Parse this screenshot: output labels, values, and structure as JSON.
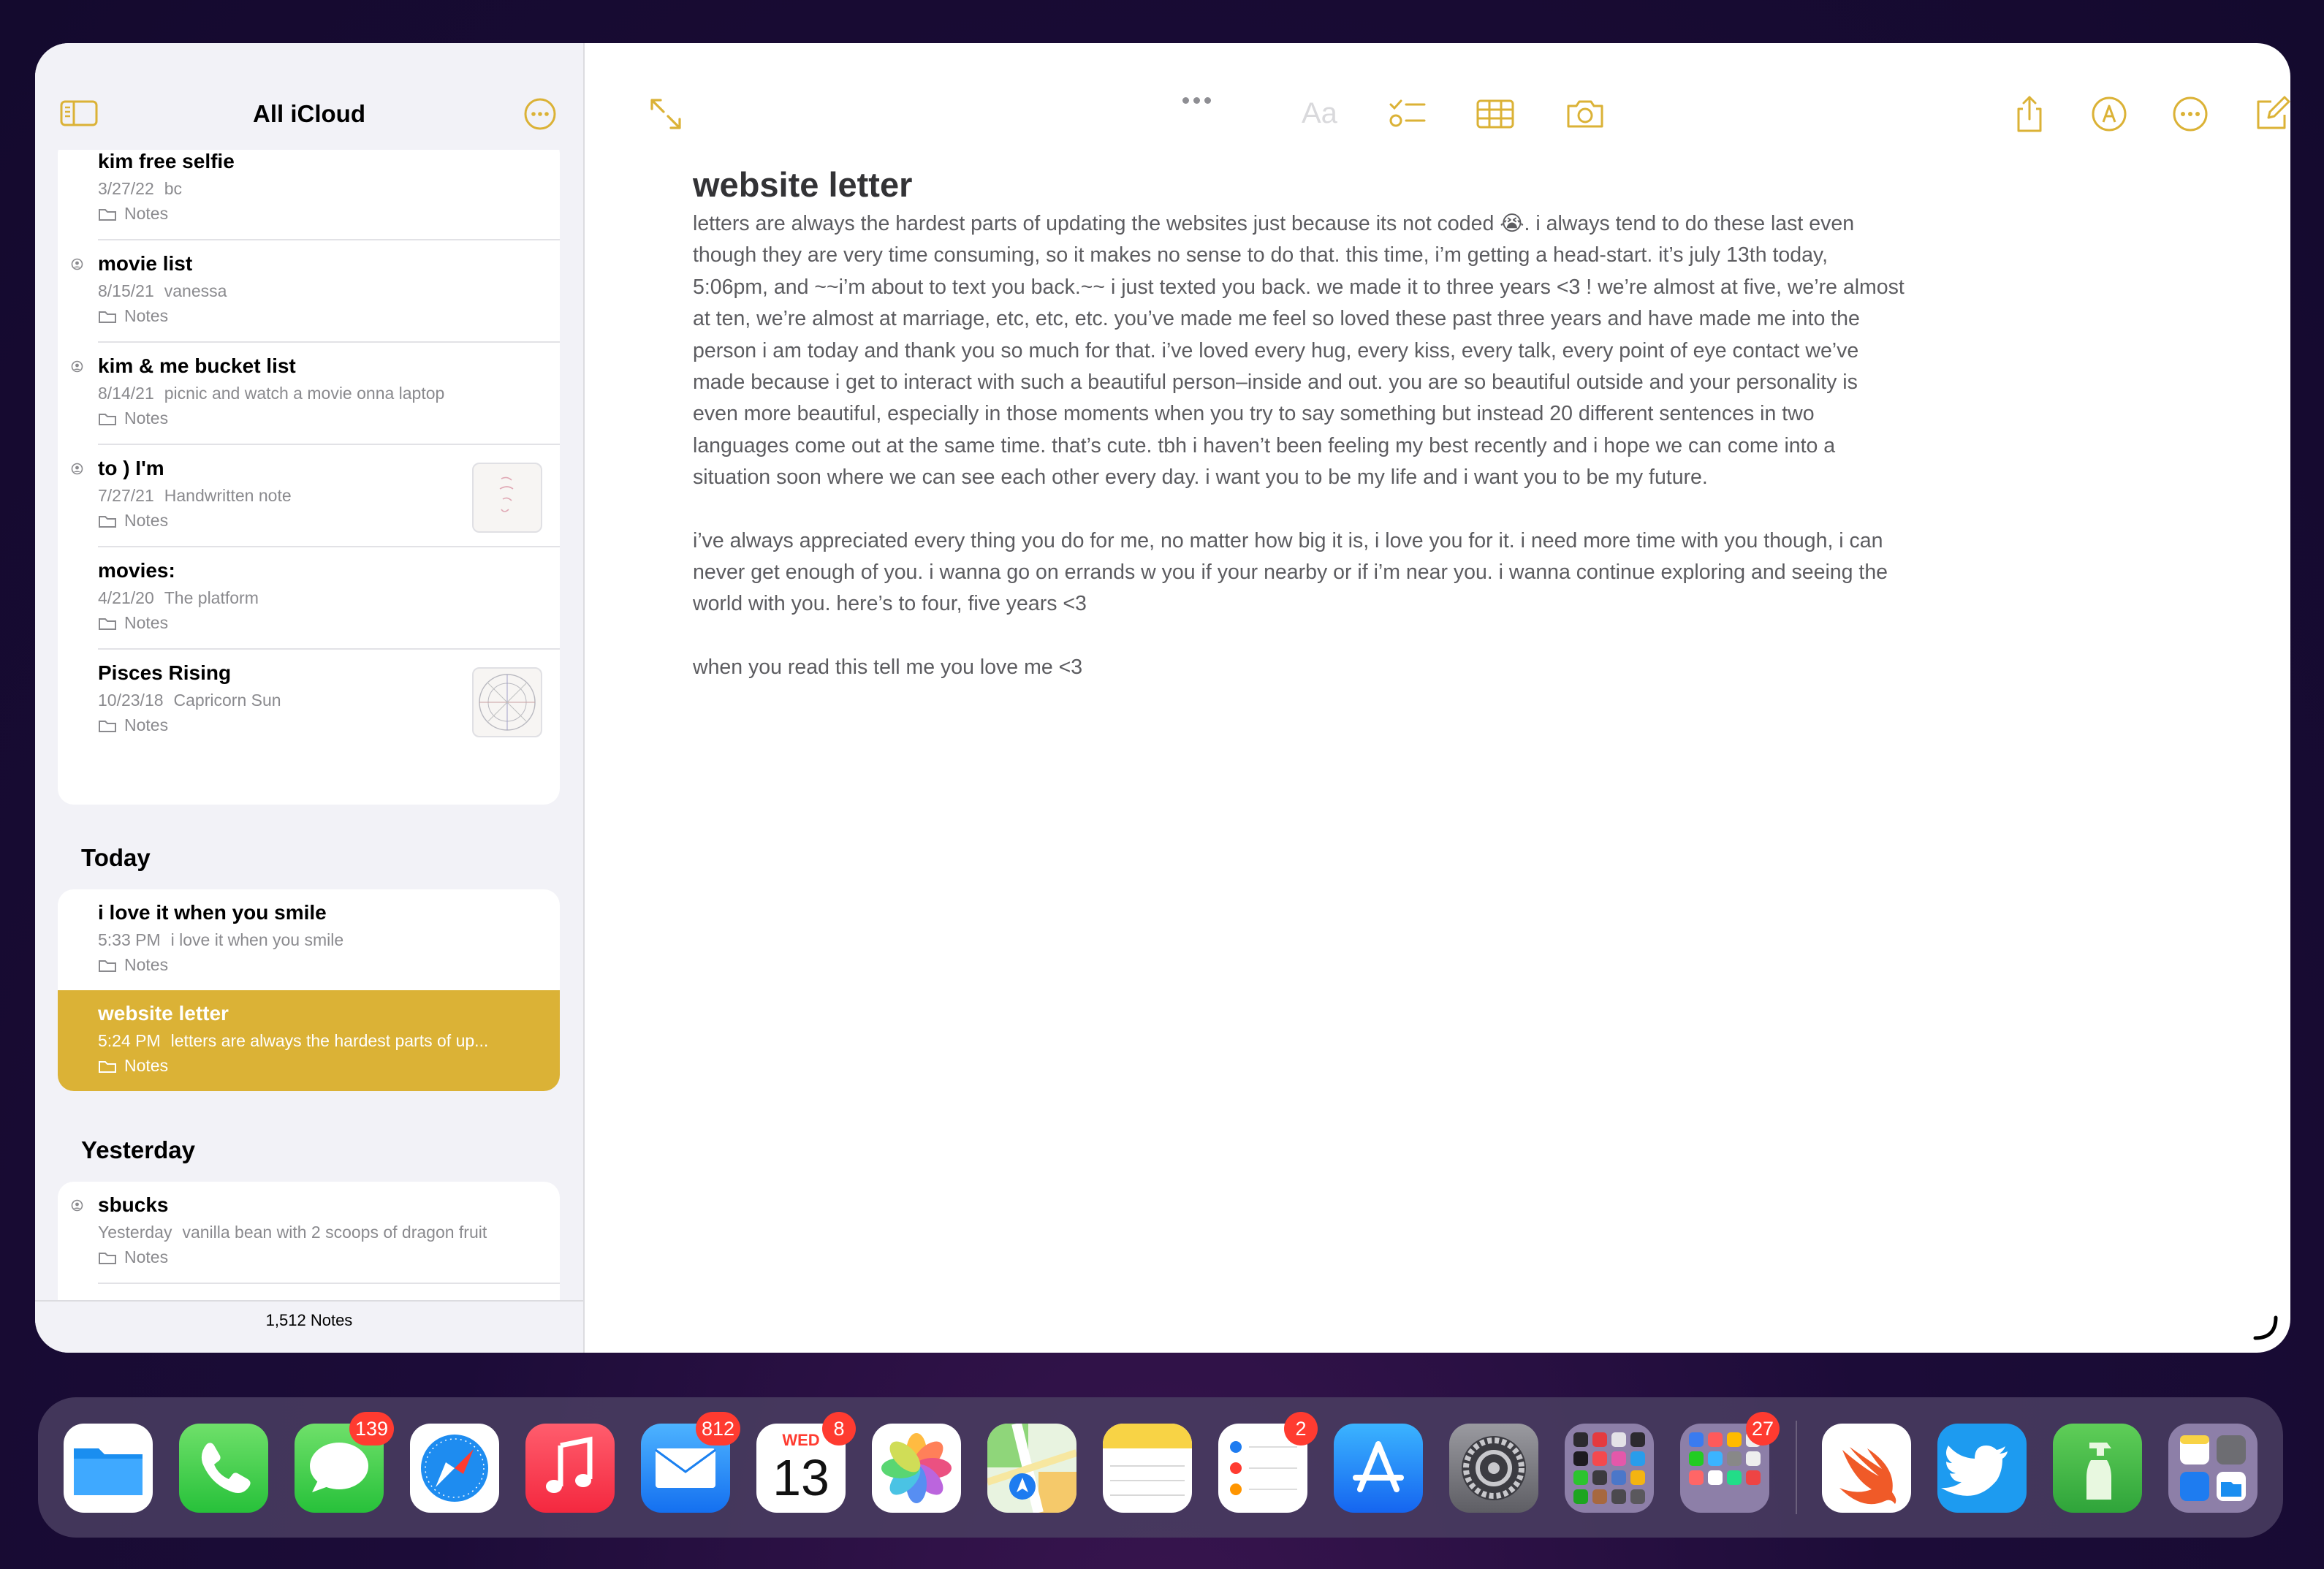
{
  "sidebar": {
    "title": "All iCloud",
    "footer": "1,512 Notes",
    "pinned_notes": [
      {
        "title": "kim free selfie",
        "date": "3/27/22",
        "preview": "bc",
        "folder": "Notes"
      },
      {
        "title": "movie list",
        "date": "8/15/21",
        "preview": "vanessa",
        "folder": "Notes"
      },
      {
        "title": "kim & me bucket list",
        "date": "8/14/21",
        "preview": "picnic and watch a movie onna laptop",
        "folder": "Notes"
      },
      {
        "title": "to ) I'm",
        "date": "7/27/21",
        "preview": "Handwritten note",
        "folder": "Notes"
      },
      {
        "title": "movies:",
        "date": "4/21/20",
        "preview": "The platform",
        "folder": "Notes"
      },
      {
        "title": "Pisces Rising",
        "date": "10/23/18",
        "preview": "Capricorn Sun",
        "folder": "Notes"
      }
    ],
    "today_label": "Today",
    "today_notes": [
      {
        "title": "i love it when you smile",
        "date": "5:33 PM",
        "preview": "i love it when you smile",
        "folder": "Notes"
      },
      {
        "title": "website letter",
        "date": "5:24 PM",
        "preview": "letters are always the hardest parts of up...",
        "folder": "Notes"
      }
    ],
    "yesterday_label": "Yesterday",
    "yesterday_notes": [
      {
        "title": "sbucks",
        "date": "Yesterday",
        "preview": "vanilla bean with 2 scoops of dragon fruit",
        "folder": "Notes"
      }
    ]
  },
  "editor": {
    "format_label": "Aa",
    "title": "website letter",
    "paragraphs": [
      "letters are always the hardest parts of updating the websites just because its not coded 😭. i always tend to do these last even though they are very time consuming, so it makes no sense to do that. this time, i’m getting a head-start. it’s july 13th today, 5:06pm, and ~~i’m about to text you back.~~ i just texted you back. we made it to three years <3 ! we’re almost at five, we’re almost at ten, we’re almost at marriage, etc, etc, etc. you’ve made me feel so loved these past three years and have made me into the person i am today and thank you so much for that. i’ve loved every hug, every kiss, every talk, every point of eye contact we’ve made because i get to interact with such a beautiful person–inside and out. you are so beautiful outside and your personality is even more beautiful, especially in those moments when you try to say something but instead 20 different sentences in two languages come out at the same time. that’s cute. tbh i haven’t been feeling my best recently and i hope we can come into a situation soon where we can see each other every day. i want you to be my life and i want you to be my future.",
      "i’ve always appreciated every thing you do for me, no matter how big it is, i love you for it. i need more time with you though, i can never get enough of you. i wanna go on errands w you if your nearby or if i’m near you. i wanna continue exploring and seeing the world with you. here’s to four, five years <3",
      "when you read this tell me you love me <3"
    ]
  },
  "dock": {
    "apps": [
      {
        "name": "Files",
        "badge": ""
      },
      {
        "name": "Phone",
        "badge": ""
      },
      {
        "name": "Messages",
        "badge": "139"
      },
      {
        "name": "Safari",
        "badge": ""
      },
      {
        "name": "Music",
        "badge": ""
      },
      {
        "name": "Mail",
        "badge": "812"
      },
      {
        "name": "Calendar",
        "badge": "8",
        "day": "WED",
        "date": "13"
      },
      {
        "name": "Photos",
        "badge": ""
      },
      {
        "name": "Maps",
        "badge": ""
      },
      {
        "name": "Notes",
        "badge": ""
      },
      {
        "name": "Reminders",
        "badge": "2"
      },
      {
        "name": "App Store",
        "badge": ""
      },
      {
        "name": "Settings",
        "badge": ""
      },
      {
        "name": "Folder 1",
        "badge": ""
      },
      {
        "name": "Folder 2",
        "badge": "27"
      },
      {
        "name": "Swift Playgrounds",
        "badge": ""
      },
      {
        "name": "Twitter",
        "badge": ""
      },
      {
        "name": "Cleaner",
        "badge": ""
      },
      {
        "name": "App Library",
        "badge": ""
      }
    ]
  },
  "colors": {
    "accent": "#dbb236",
    "badge": "#ff3b30"
  }
}
